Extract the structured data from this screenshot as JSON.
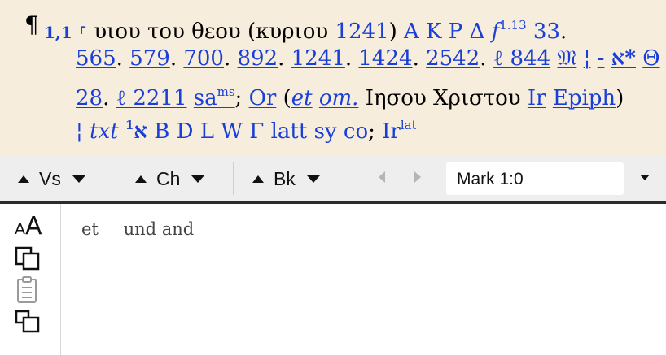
{
  "apparatus": {
    "para_mark": "¶",
    "verse_ref": "1,1",
    "variant_mark": "⸀",
    "lemma": "υιου του θεου",
    "paren_open": "(",
    "reading": "κυριου",
    "w_1241": "1241",
    "paren_close": ")",
    "w_A": "A",
    "w_K": "K",
    "w_P": "P",
    "w_Delta": "Δ",
    "w_f": "f",
    "w_f_sup": "1.13",
    "w_33": "33",
    "w_565": "565",
    "w_579": "579",
    "w_700": "700",
    "w_892": "892",
    "w_1241b": "1241",
    "w_1424": "1424",
    "w_2542": "2542",
    "w_l844": "ℓ 844",
    "w_M": "𝔐",
    "w_sep1": "¦",
    "w_dash": "-",
    "w_aleph_star": "א*",
    "w_Theta": "Θ",
    "w_28": "28",
    "w_l2211": "ℓ 2211",
    "w_sa": "sa",
    "w_sa_sup": "ms",
    "w_Or": "Or",
    "w_et": "et",
    "w_om": "om.",
    "greek_phrase": "Ιησου Χριστου",
    "w_Ir": "Ir",
    "w_Epiph": "Epiph",
    "w_sep2": "¦",
    "w_txt": "txt",
    "w_aleph1": "א",
    "w_aleph1_sup": "1",
    "w_B": "B",
    "w_D": "D",
    "w_L": "L",
    "w_W": "W",
    "w_Gamma": "Γ",
    "w_latt": "latt",
    "w_sy": "sy",
    "w_co": "co",
    "w_Ir2": "Ir",
    "w_Ir2_sup": "lat"
  },
  "toolbar": {
    "verse_label": "Vs",
    "chapter_label": "Ch",
    "book_label": "Bk",
    "reference": "Mark 1:0"
  },
  "content": {
    "words": [
      "et",
      "und and"
    ]
  },
  "colors": {
    "apparatus_bg": "#f7eddd",
    "link": "#1a3fd6",
    "toolbar_bg": "#eeeeee"
  },
  "icons": [
    "font-size-icon",
    "copy-icon",
    "clipboard-icon",
    "duplicate-window-icon",
    "triangle-up-icon",
    "triangle-down-icon",
    "nav-left-icon",
    "nav-right-icon"
  ]
}
